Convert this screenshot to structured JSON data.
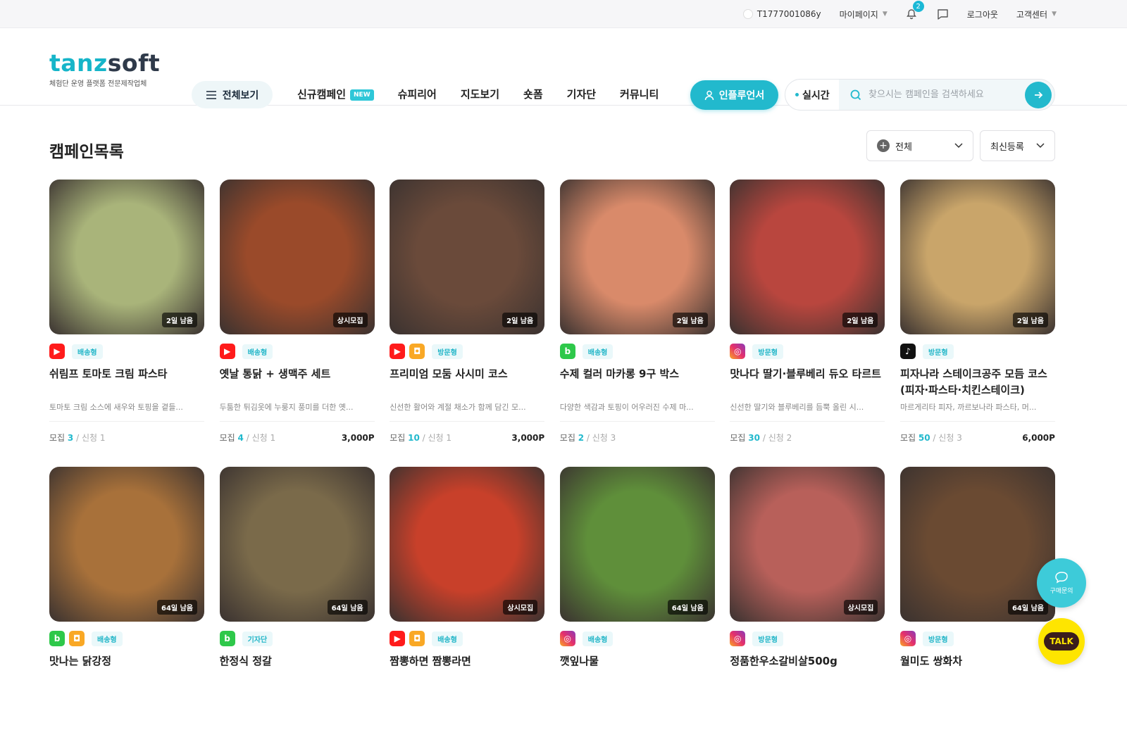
{
  "topbar": {
    "user_id": "T1777001086y",
    "mypage": "마이페이지",
    "notification_count": "2",
    "logout": "로그아웃",
    "support": "고객센터"
  },
  "header": {
    "logo_left": "tanz",
    "logo_right": "soft",
    "logo_sub": "체험단 운영 플랫폼 전문제작업체",
    "view_all": "전체보기",
    "nav": [
      "신규캠페인",
      "슈피리어",
      "지도보기",
      "숏폼",
      "기자단",
      "커뮤니티"
    ],
    "new_badge": "NEW",
    "influencer": "인플루언서",
    "realtime": "실시간",
    "search_placeholder": "찾으시는 캠페인을 검색하세요"
  },
  "main": {
    "title": "캠페인목록",
    "filter_category": "전체",
    "filter_sort": "최신등록"
  },
  "cards": [
    {
      "title": "쉬림프 토마토 크림 파스타",
      "desc": "토마토 크림 소스에 새우와 토핑을 곁들...",
      "deadline": "2일 남음",
      "type": "배송형",
      "channels": [
        "yt"
      ],
      "recruit": "3",
      "apply": "1",
      "point": "",
      "bg": "#a9b47a"
    },
    {
      "title": "옛날 통닭 + 생맥주 세트",
      "desc": "두툼한 튀김옷에 누룽지 풍미를 더한 옛...",
      "deadline": "상시모집",
      "type": "배송형",
      "channels": [
        "yt"
      ],
      "recruit": "4",
      "apply": "1",
      "point": "3,000P",
      "bg": "#9a4a2a"
    },
    {
      "title": "프리미엄 모둠 사시미 코스",
      "desc": "신선한 활어와 계절 채소가 함께 담긴 모...",
      "deadline": "2일 남음",
      "type": "방문형",
      "channels": [
        "yt",
        "cl"
      ],
      "recruit": "10",
      "apply": "1",
      "point": "3,000P",
      "bg": "#6a4a3a"
    },
    {
      "title": "수제 컬러 마카롱 9구 박스",
      "desc": "다양한 색감과 토핑이 어우러진 수제 마...",
      "deadline": "2일 남음",
      "type": "배송형",
      "channels": [
        "blog"
      ],
      "recruit": "2",
      "apply": "3",
      "point": "",
      "bg": "#d98a6a"
    },
    {
      "title": "맛나다 딸기·블루베리 듀오 타르트",
      "desc": "신선한 딸기와 블루베리를 듬뿍 올린 시...",
      "deadline": "2일 남음",
      "type": "방문형",
      "channels": [
        "ig"
      ],
      "recruit": "30",
      "apply": "2",
      "point": "",
      "bg": "#b9463e"
    },
    {
      "title": "피자나라 스테이크공주 모듬 코스 (피자·파스타·치킨스테이크)",
      "desc": "마르게리타 피자, 까르보나라 파스타, 머...",
      "deadline": "2일 남음",
      "type": "방문형",
      "channels": [
        "tt"
      ],
      "recruit": "50",
      "apply": "3",
      "point": "6,000P",
      "bg": "#c9a56a"
    },
    {
      "title": "맛나는 닭강정",
      "desc": "",
      "deadline": "64일 남음",
      "type": "배송형",
      "channels": [
        "blog",
        "cl"
      ],
      "recruit": "",
      "apply": "",
      "point": "",
      "bg": "#a8713a"
    },
    {
      "title": "한정식 정갈",
      "desc": "",
      "deadline": "64일 남음",
      "type": "기자단",
      "channels": [
        "blog"
      ],
      "recruit": "",
      "apply": "",
      "point": "",
      "bg": "#7a6a4a"
    },
    {
      "title": "짬뽕하면 짬뽕라면",
      "desc": "",
      "deadline": "상시모집",
      "type": "배송형",
      "channels": [
        "yt",
        "cl"
      ],
      "recruit": "",
      "apply": "",
      "point": "",
      "bg": "#c8402a"
    },
    {
      "title": "깻잎나물",
      "desc": "",
      "deadline": "64일 남음",
      "type": "배송형",
      "channels": [
        "ig"
      ],
      "recruit": "",
      "apply": "",
      "point": "",
      "bg": "#5f8f3a"
    },
    {
      "title": "정품한우소갈비살500g",
      "desc": "",
      "deadline": "상시모집",
      "type": "방문형",
      "channels": [
        "ig"
      ],
      "recruit": "",
      "apply": "",
      "point": "",
      "bg": "#b8605a"
    },
    {
      "title": "월미도 쌍화차",
      "desc": "",
      "deadline": "64일 남음",
      "type": "방문형",
      "channels": [
        "ig"
      ],
      "recruit": "",
      "apply": "",
      "point": "",
      "bg": "#6a4a32"
    }
  ],
  "labels": {
    "recruit": "모집",
    "apply": "신청"
  },
  "fab": {
    "inquiry": "구매문의",
    "talk": "TALK"
  }
}
